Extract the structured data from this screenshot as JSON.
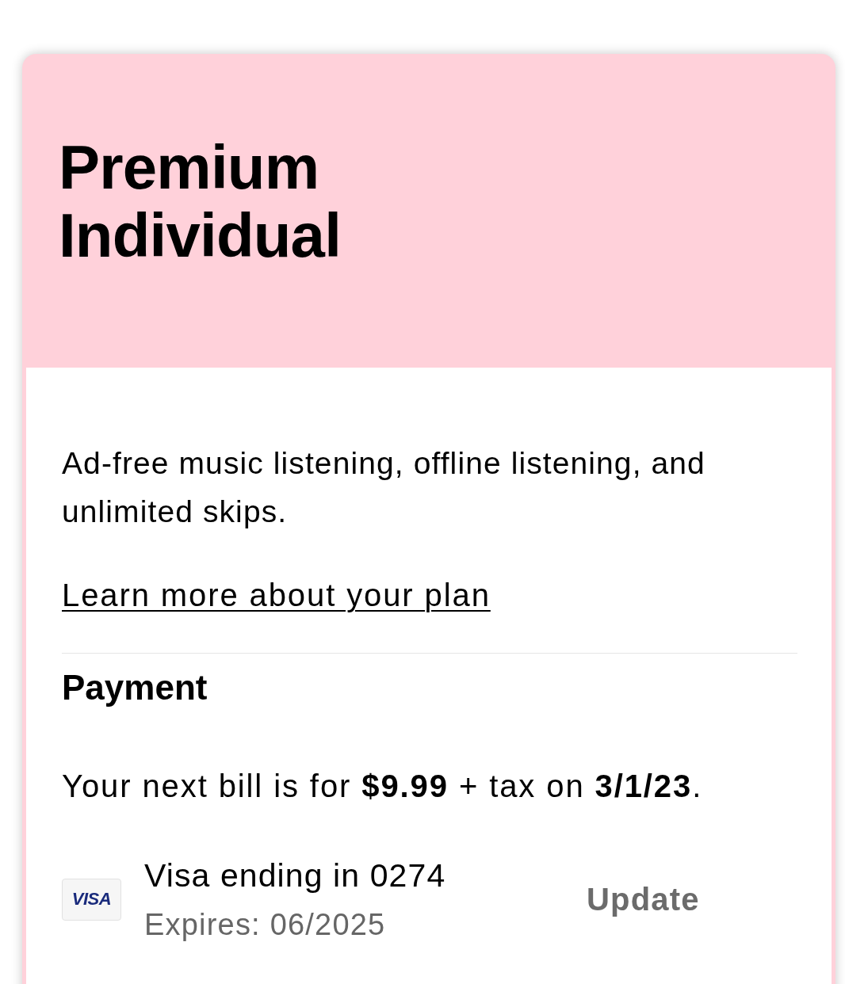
{
  "plan": {
    "name": "Premium Individual",
    "description": "Ad-free music listening, offline listening, and unlimited skips.",
    "link": "Learn more about your plan"
  },
  "payment": {
    "heading": "Payment",
    "next_bill": "Your next bill is for **$9.99** + tax on **3/1/23**.",
    "method": {
      "brand_logo": "VISA",
      "label": "Visa ending in 0274",
      "expires": "Expires: 06/2025",
      "action": "Update"
    }
  }
}
